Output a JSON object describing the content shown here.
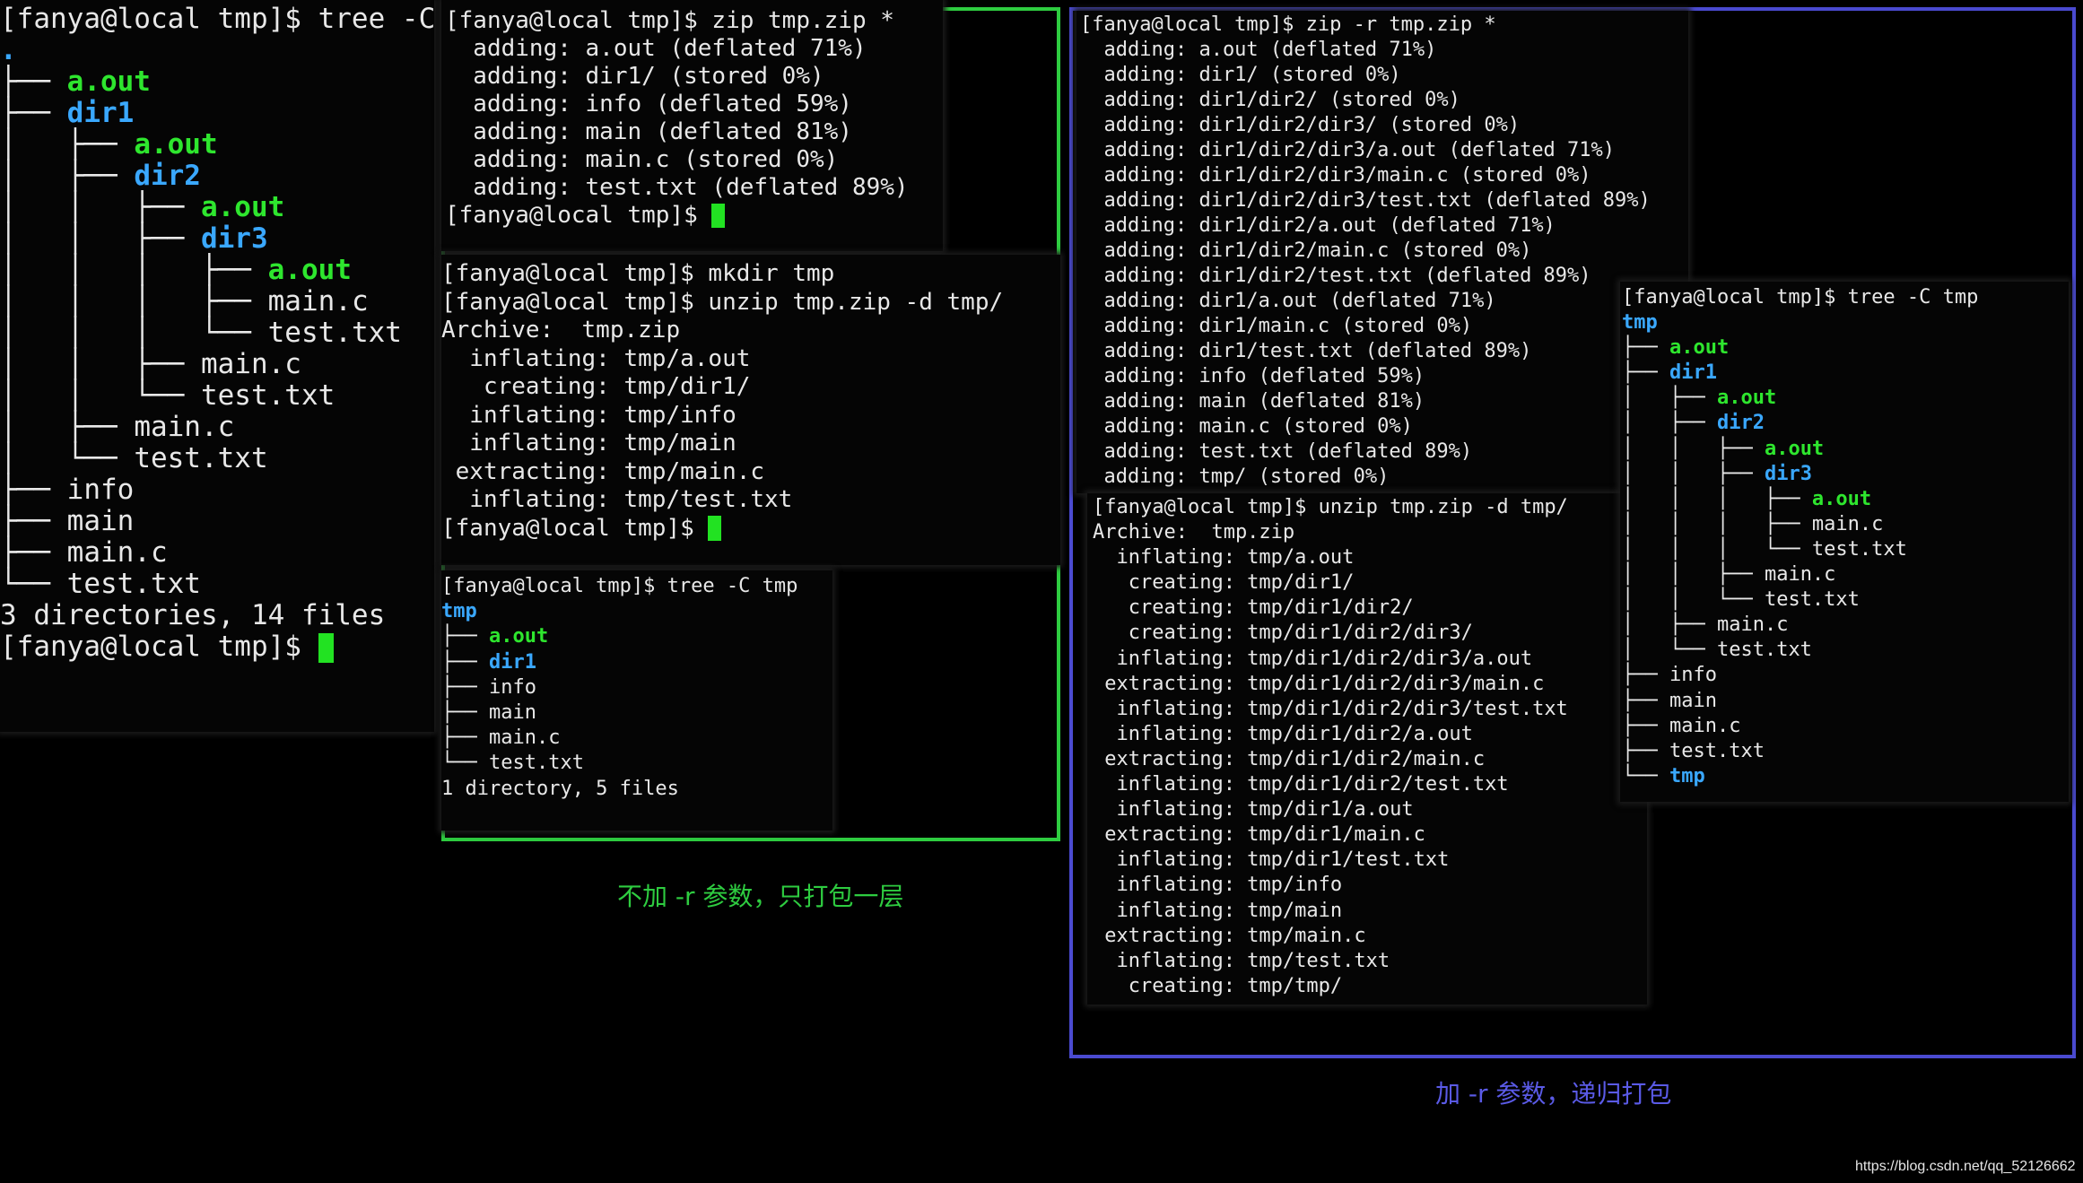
{
  "terminal_left": {
    "lines": [
      [
        {
          "t": "[fanya@local tmp]$ tree -C",
          "c": "w"
        }
      ],
      [
        {
          "t": ".",
          "c": "b"
        }
      ],
      [
        {
          "t": "├── ",
          "c": "t"
        },
        {
          "t": "a.out",
          "c": "g"
        }
      ],
      [
        {
          "t": "├── ",
          "c": "t"
        },
        {
          "t": "dir1",
          "c": "b"
        }
      ],
      [
        {
          "t": "│   ├── ",
          "c": "t"
        },
        {
          "t": "a.out",
          "c": "g"
        }
      ],
      [
        {
          "t": "│   ├── ",
          "c": "t"
        },
        {
          "t": "dir2",
          "c": "b"
        }
      ],
      [
        {
          "t": "│   │   ├── ",
          "c": "t"
        },
        {
          "t": "a.out",
          "c": "g"
        }
      ],
      [
        {
          "t": "│   │   ├── ",
          "c": "t"
        },
        {
          "t": "dir3",
          "c": "b"
        }
      ],
      [
        {
          "t": "│   │   │   ├── ",
          "c": "t"
        },
        {
          "t": "a.out",
          "c": "g"
        }
      ],
      [
        {
          "t": "│   │   │   ├── ",
          "c": "t"
        },
        {
          "t": "main.c",
          "c": "w"
        }
      ],
      [
        {
          "t": "│   │   │   └── ",
          "c": "t"
        },
        {
          "t": "test.txt",
          "c": "w"
        }
      ],
      [
        {
          "t": "│   │   ├── ",
          "c": "t"
        },
        {
          "t": "main.c",
          "c": "w"
        }
      ],
      [
        {
          "t": "│   │   └── ",
          "c": "t"
        },
        {
          "t": "test.txt",
          "c": "w"
        }
      ],
      [
        {
          "t": "│   ├── ",
          "c": "t"
        },
        {
          "t": "main.c",
          "c": "w"
        }
      ],
      [
        {
          "t": "│   └── ",
          "c": "t"
        },
        {
          "t": "test.txt",
          "c": "w"
        }
      ],
      [
        {
          "t": "├── ",
          "c": "t"
        },
        {
          "t": "info",
          "c": "w"
        }
      ],
      [
        {
          "t": "├── ",
          "c": "t"
        },
        {
          "t": "main",
          "c": "w"
        }
      ],
      [
        {
          "t": "├── ",
          "c": "t"
        },
        {
          "t": "main.c",
          "c": "w"
        }
      ],
      [
        {
          "t": "└── ",
          "c": "t"
        },
        {
          "t": "test.txt",
          "c": "w"
        }
      ],
      [
        {
          "t": "",
          "c": "w"
        }
      ],
      [
        {
          "t": "3 directories, 14 files",
          "c": "w"
        }
      ],
      [
        {
          "t": "[fanya@local tmp]$ ",
          "c": "w"
        },
        {
          "t": "",
          "c": "cursor"
        }
      ]
    ]
  },
  "terminal_zip": {
    "lines": [
      [
        {
          "t": "[fanya@local tmp]$ zip tmp.zip *",
          "c": "w"
        }
      ],
      [
        {
          "t": "  adding: a.out (deflated 71%)",
          "c": "w"
        }
      ],
      [
        {
          "t": "  adding: dir1/ (stored 0%)",
          "c": "w"
        }
      ],
      [
        {
          "t": "  adding: info (deflated 59%)",
          "c": "w"
        }
      ],
      [
        {
          "t": "  adding: main (deflated 81%)",
          "c": "w"
        }
      ],
      [
        {
          "t": "  adding: main.c (stored 0%)",
          "c": "w"
        }
      ],
      [
        {
          "t": "  adding: test.txt (deflated 89%)",
          "c": "w"
        }
      ],
      [
        {
          "t": "[fanya@local tmp]$ ",
          "c": "w"
        },
        {
          "t": "",
          "c": "cursor"
        }
      ]
    ]
  },
  "terminal_unzip": {
    "lines": [
      [
        {
          "t": "[fanya@local tmp]$ mkdir tmp",
          "c": "w"
        }
      ],
      [
        {
          "t": "[fanya@local tmp]$ unzip tmp.zip -d tmp/",
          "c": "w"
        }
      ],
      [
        {
          "t": "Archive:  tmp.zip",
          "c": "w"
        }
      ],
      [
        {
          "t": "  inflating: tmp/a.out",
          "c": "w"
        }
      ],
      [
        {
          "t": "   creating: tmp/dir1/",
          "c": "w"
        }
      ],
      [
        {
          "t": "  inflating: tmp/info",
          "c": "w"
        }
      ],
      [
        {
          "t": "  inflating: tmp/main",
          "c": "w"
        }
      ],
      [
        {
          "t": " extracting: tmp/main.c",
          "c": "w"
        }
      ],
      [
        {
          "t": "  inflating: tmp/test.txt",
          "c": "w"
        }
      ],
      [
        {
          "t": "[fanya@local tmp]$ ",
          "c": "w"
        },
        {
          "t": "",
          "c": "cursor"
        }
      ]
    ]
  },
  "terminal_tree_small": {
    "lines": [
      [
        {
          "t": "[fanya@local tmp]$ tree -C tmp",
          "c": "w"
        }
      ],
      [
        {
          "t": "tmp",
          "c": "b"
        }
      ],
      [
        {
          "t": "├── ",
          "c": "t"
        },
        {
          "t": "a.out",
          "c": "g"
        }
      ],
      [
        {
          "t": "├── ",
          "c": "t"
        },
        {
          "t": "dir1",
          "c": "b"
        }
      ],
      [
        {
          "t": "├── ",
          "c": "t"
        },
        {
          "t": "info",
          "c": "w"
        }
      ],
      [
        {
          "t": "├── ",
          "c": "t"
        },
        {
          "t": "main",
          "c": "w"
        }
      ],
      [
        {
          "t": "├── ",
          "c": "t"
        },
        {
          "t": "main.c",
          "c": "w"
        }
      ],
      [
        {
          "t": "└── ",
          "c": "t"
        },
        {
          "t": "test.txt",
          "c": "w"
        }
      ],
      [
        {
          "t": "",
          "c": "w"
        }
      ],
      [
        {
          "t": "1 directory, 5 files",
          "c": "w"
        }
      ]
    ]
  },
  "terminal_zip_r": {
    "lines": [
      [
        {
          "t": "[fanya@local tmp]$ zip -r tmp.zip *",
          "c": "w"
        }
      ],
      [
        {
          "t": "  adding: a.out (deflated 71%)",
          "c": "w"
        }
      ],
      [
        {
          "t": "  adding: dir1/ (stored 0%)",
          "c": "w"
        }
      ],
      [
        {
          "t": "  adding: dir1/dir2/ (stored 0%)",
          "c": "w"
        }
      ],
      [
        {
          "t": "  adding: dir1/dir2/dir3/ (stored 0%)",
          "c": "w"
        }
      ],
      [
        {
          "t": "  adding: dir1/dir2/dir3/a.out (deflated 71%)",
          "c": "w"
        }
      ],
      [
        {
          "t": "  adding: dir1/dir2/dir3/main.c (stored 0%)",
          "c": "w"
        }
      ],
      [
        {
          "t": "  adding: dir1/dir2/dir3/test.txt (deflated 89%)",
          "c": "w"
        }
      ],
      [
        {
          "t": "  adding: dir1/dir2/a.out (deflated 71%)",
          "c": "w"
        }
      ],
      [
        {
          "t": "  adding: dir1/dir2/main.c (stored 0%)",
          "c": "w"
        }
      ],
      [
        {
          "t": "  adding: dir1/dir2/test.txt (deflated 89%)",
          "c": "w"
        }
      ],
      [
        {
          "t": "  adding: dir1/a.out (deflated 71%)",
          "c": "w"
        }
      ],
      [
        {
          "t": "  adding: dir1/main.c (stored 0%)",
          "c": "w"
        }
      ],
      [
        {
          "t": "  adding: dir1/test.txt (deflated 89%)",
          "c": "w"
        }
      ],
      [
        {
          "t": "  adding: info (deflated 59%)",
          "c": "w"
        }
      ],
      [
        {
          "t": "  adding: main (deflated 81%)",
          "c": "w"
        }
      ],
      [
        {
          "t": "  adding: main.c (stored 0%)",
          "c": "w"
        }
      ],
      [
        {
          "t": "  adding: test.txt (deflated 89%)",
          "c": "w"
        }
      ],
      [
        {
          "t": "  adding: tmp/ (stored 0%)",
          "c": "w"
        }
      ]
    ]
  },
  "terminal_unzip_r": {
    "lines": [
      [
        {
          "t": "[fanya@local tmp]$ unzip tmp.zip -d tmp/",
          "c": "w"
        }
      ],
      [
        {
          "t": "Archive:  tmp.zip",
          "c": "w"
        }
      ],
      [
        {
          "t": "  inflating: tmp/a.out",
          "c": "w"
        }
      ],
      [
        {
          "t": "   creating: tmp/dir1/",
          "c": "w"
        }
      ],
      [
        {
          "t": "   creating: tmp/dir1/dir2/",
          "c": "w"
        }
      ],
      [
        {
          "t": "   creating: tmp/dir1/dir2/dir3/",
          "c": "w"
        }
      ],
      [
        {
          "t": "  inflating: tmp/dir1/dir2/dir3/a.out",
          "c": "w"
        }
      ],
      [
        {
          "t": " extracting: tmp/dir1/dir2/dir3/main.c",
          "c": "w"
        }
      ],
      [
        {
          "t": "  inflating: tmp/dir1/dir2/dir3/test.txt",
          "c": "w"
        }
      ],
      [
        {
          "t": "  inflating: tmp/dir1/dir2/a.out",
          "c": "w"
        }
      ],
      [
        {
          "t": " extracting: tmp/dir1/dir2/main.c",
          "c": "w"
        }
      ],
      [
        {
          "t": "  inflating: tmp/dir1/dir2/test.txt",
          "c": "w"
        }
      ],
      [
        {
          "t": "  inflating: tmp/dir1/a.out",
          "c": "w"
        }
      ],
      [
        {
          "t": " extracting: tmp/dir1/main.c",
          "c": "w"
        }
      ],
      [
        {
          "t": "  inflating: tmp/dir1/test.txt",
          "c": "w"
        }
      ],
      [
        {
          "t": "  inflating: tmp/info",
          "c": "w"
        }
      ],
      [
        {
          "t": "  inflating: tmp/main",
          "c": "w"
        }
      ],
      [
        {
          "t": " extracting: tmp/main.c",
          "c": "w"
        }
      ],
      [
        {
          "t": "  inflating: tmp/test.txt",
          "c": "w"
        }
      ],
      [
        {
          "t": "   creating: tmp/tmp/",
          "c": "w"
        }
      ]
    ]
  },
  "terminal_tree_r": {
    "lines": [
      [
        {
          "t": "[fanya@local tmp]$ tree -C tmp",
          "c": "w"
        }
      ],
      [
        {
          "t": "tmp",
          "c": "b"
        }
      ],
      [
        {
          "t": "├── ",
          "c": "t"
        },
        {
          "t": "a.out",
          "c": "g"
        }
      ],
      [
        {
          "t": "├── ",
          "c": "t"
        },
        {
          "t": "dir1",
          "c": "b"
        }
      ],
      [
        {
          "t": "│   ├── ",
          "c": "t"
        },
        {
          "t": "a.out",
          "c": "g"
        }
      ],
      [
        {
          "t": "│   ├── ",
          "c": "t"
        },
        {
          "t": "dir2",
          "c": "b"
        }
      ],
      [
        {
          "t": "│   │   ├── ",
          "c": "t"
        },
        {
          "t": "a.out",
          "c": "g"
        }
      ],
      [
        {
          "t": "│   │   ├── ",
          "c": "t"
        },
        {
          "t": "dir3",
          "c": "b"
        }
      ],
      [
        {
          "t": "│   │   │   ├── ",
          "c": "t"
        },
        {
          "t": "a.out",
          "c": "g"
        }
      ],
      [
        {
          "t": "│   │   │   ├── ",
          "c": "t"
        },
        {
          "t": "main.c",
          "c": "w"
        }
      ],
      [
        {
          "t": "│   │   │   └── ",
          "c": "t"
        },
        {
          "t": "test.txt",
          "c": "w"
        }
      ],
      [
        {
          "t": "│   │   ├── ",
          "c": "t"
        },
        {
          "t": "main.c",
          "c": "w"
        }
      ],
      [
        {
          "t": "│   │   └── ",
          "c": "t"
        },
        {
          "t": "test.txt",
          "c": "w"
        }
      ],
      [
        {
          "t": "│   ├── ",
          "c": "t"
        },
        {
          "t": "main.c",
          "c": "w"
        }
      ],
      [
        {
          "t": "│   └── ",
          "c": "t"
        },
        {
          "t": "test.txt",
          "c": "w"
        }
      ],
      [
        {
          "t": "├── ",
          "c": "t"
        },
        {
          "t": "info",
          "c": "w"
        }
      ],
      [
        {
          "t": "├── ",
          "c": "t"
        },
        {
          "t": "main",
          "c": "w"
        }
      ],
      [
        {
          "t": "├── ",
          "c": "t"
        },
        {
          "t": "main.c",
          "c": "w"
        }
      ],
      [
        {
          "t": "├── ",
          "c": "t"
        },
        {
          "t": "test.txt",
          "c": "w"
        }
      ],
      [
        {
          "t": "└── ",
          "c": "t"
        },
        {
          "t": "tmp",
          "c": "b"
        }
      ]
    ]
  },
  "captions": {
    "green": "不加 -r 参数，只打包一层",
    "blue": "加 -r 参数，递归打包"
  },
  "footer": "https://blog.csdn.net/qq_52126662",
  "colors": {
    "green_frame": "#2ecc40",
    "blue_frame": "#4a4ad0",
    "green_caption": "#2ecc40",
    "blue_caption": "#5a5ae6",
    "exec_file": "#2ee62e",
    "directory": "#3aa8ff",
    "cursor": "#22e222"
  }
}
